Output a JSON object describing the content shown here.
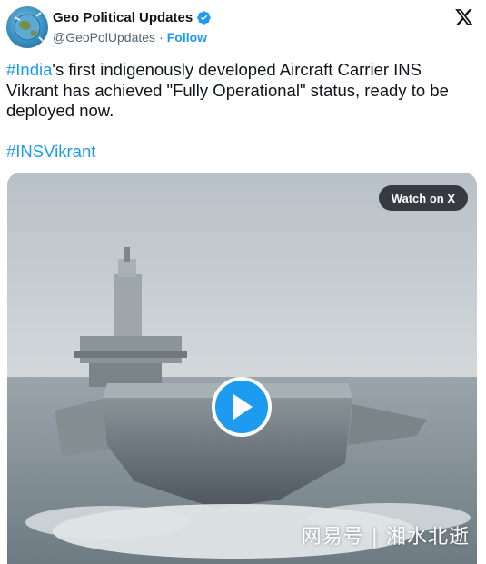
{
  "author": {
    "name": "Geo Political Updates",
    "handle": "@GeoPolUpdates",
    "separator": "·",
    "follow_label": "Follow"
  },
  "tweet": {
    "hashtag1": "#India",
    "text1": "'s first indigenously developed Aircraft Carrier INS Vikrant has achieved \"Fully Operational\" status, ready to be deployed now.",
    "hashtag2": "#INSVikrant"
  },
  "media": {
    "watch_label": "Watch on X",
    "watermark": "网易号 | 湘水北逝"
  },
  "colors": {
    "accent": "#1d9bf0",
    "text": "#0f1419",
    "muted": "#536471"
  },
  "icons": {
    "verified": "verified-badge-icon",
    "x": "x-logo-icon",
    "play": "play-icon"
  }
}
